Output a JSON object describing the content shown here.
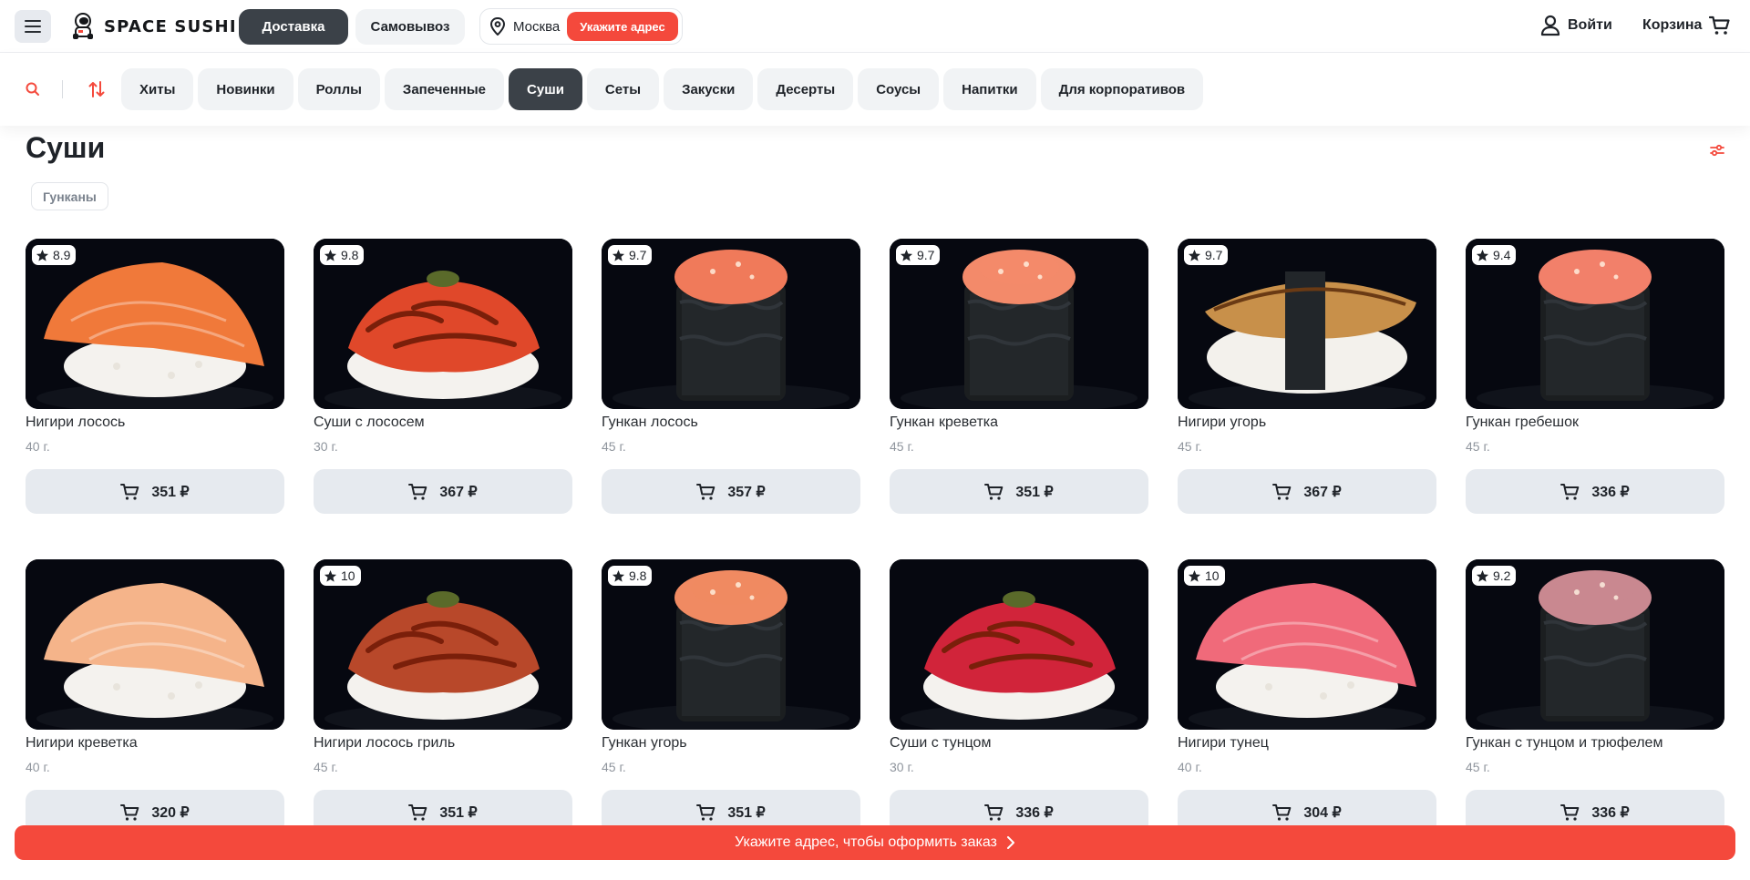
{
  "header": {
    "logo_text": "SPACE SUSHI",
    "mode_delivery": "Доставка",
    "mode_pickup": "Самовывоз",
    "city": "Москва",
    "address_button": "Укажите адрес",
    "login": "Войти",
    "cart": "Корзина"
  },
  "categories": [
    "Хиты",
    "Новинки",
    "Роллы",
    "Запеченные",
    "Суши",
    "Сеты",
    "Закуски",
    "Десерты",
    "Соусы",
    "Напитки",
    "Для корпоративов"
  ],
  "active_category": "Суши",
  "page": {
    "title": "Суши",
    "subcategory": "Гунканы"
  },
  "products": [
    {
      "name": "Нигири лосось",
      "weight": "40 г.",
      "price": "351 ₽",
      "rating": "8.9",
      "kind": "nigiri",
      "color": "#f0793a"
    },
    {
      "name": "Суши с лососем",
      "weight": "30 г.",
      "price": "367 ₽",
      "rating": "9.8",
      "kind": "nigiri-sauce",
      "color": "#e0482a"
    },
    {
      "name": "Гункан лосось",
      "weight": "45 г.",
      "price": "357 ₽",
      "rating": "9.7",
      "kind": "gunkan",
      "color": "#f07a5a"
    },
    {
      "name": "Гункан креветка",
      "weight": "45 г.",
      "price": "351 ₽",
      "rating": "9.7",
      "kind": "gunkan",
      "color": "#f38a6a"
    },
    {
      "name": "Нигири угорь",
      "weight": "45 г.",
      "price": "367 ₽",
      "rating": "9.7",
      "kind": "eel",
      "color": "#c8904a"
    },
    {
      "name": "Гункан гребешок",
      "weight": "45 г.",
      "price": "336 ₽",
      "rating": "9.4",
      "kind": "gunkan",
      "color": "#f2806a"
    },
    {
      "name": "Нигири креветка",
      "weight": "40 г.",
      "price": "320 ₽",
      "rating": "",
      "kind": "nigiri",
      "color": "#f5b48a"
    },
    {
      "name": "Нигири лосось гриль",
      "weight": "45 г.",
      "price": "351 ₽",
      "rating": "10",
      "kind": "nigiri-sauce",
      "color": "#b8482a"
    },
    {
      "name": "Гункан угорь",
      "weight": "45 г.",
      "price": "351 ₽",
      "rating": "9.8",
      "kind": "gunkan",
      "color": "#f08a62"
    },
    {
      "name": "Суши с тунцом",
      "weight": "30 г.",
      "price": "336 ₽",
      "rating": "",
      "kind": "nigiri-sauce",
      "color": "#d1243a"
    },
    {
      "name": "Нигири тунец",
      "weight": "40 г.",
      "price": "304 ₽",
      "rating": "10",
      "kind": "nigiri",
      "color": "#f06a7a"
    },
    {
      "name": "Гункан с тунцом и трюфелем",
      "weight": "45 г.",
      "price": "336 ₽",
      "rating": "9.2",
      "kind": "gunkan",
      "color": "#c98890"
    }
  ],
  "bottom_bar": "Укажите адрес, чтобы оформить заказ",
  "colors": {
    "accent": "#f4493c",
    "dark": "#3b4148",
    "chip": "#f1f3f5",
    "buy": "#e6eaef"
  },
  "icons": [
    "menu-icon",
    "astronaut-logo",
    "location-pin-icon",
    "user-icon",
    "cart-icon",
    "search-icon",
    "sort-icon",
    "filter-icon",
    "star-icon",
    "chevron-right-icon"
  ]
}
